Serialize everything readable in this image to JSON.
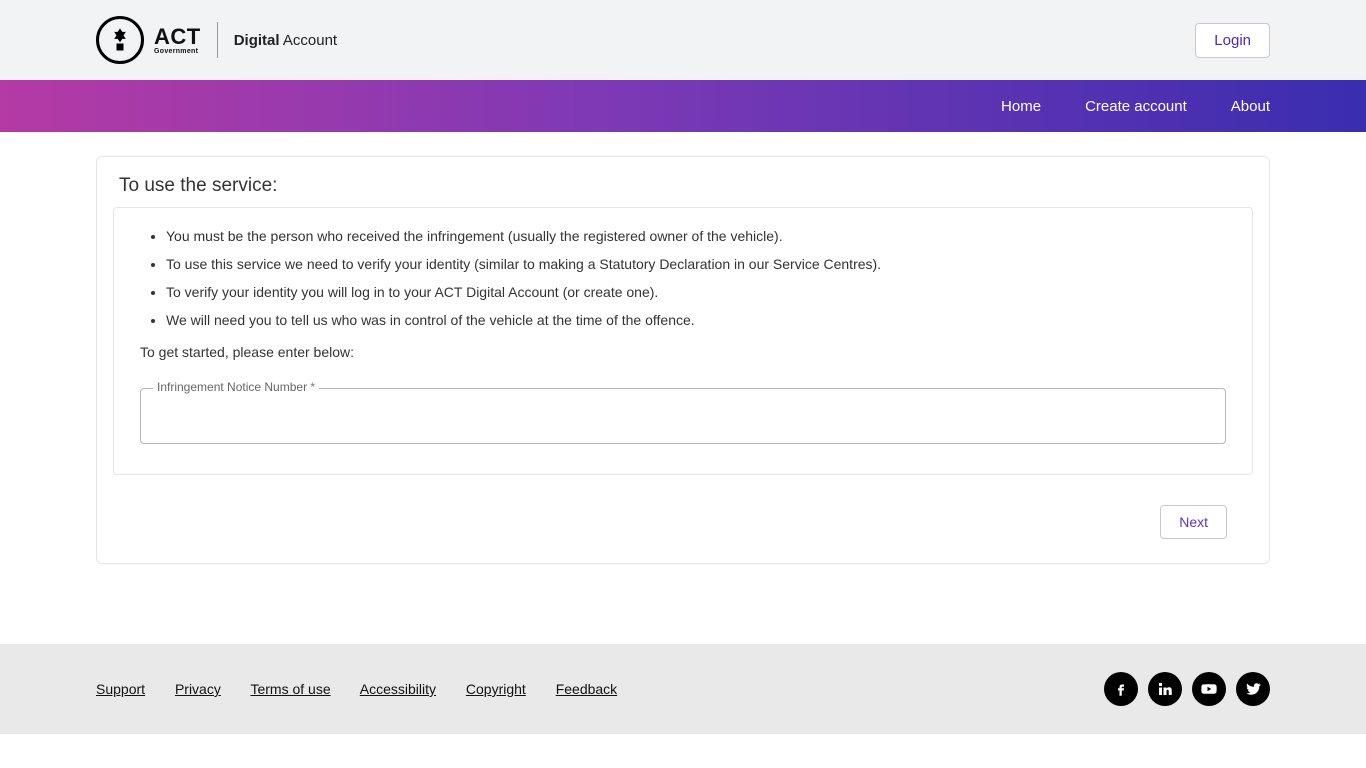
{
  "header": {
    "brand_main": "ACT",
    "brand_sub": "Government",
    "brand_right_bold": "Digital",
    "brand_right_light": " Account",
    "login_label": "Login"
  },
  "nav": {
    "home": "Home",
    "create": "Create account",
    "about": "About"
  },
  "card": {
    "title": "To use the service:",
    "bullets": [
      "You must be the person who received the infringement (usually the registered owner of the vehicle).",
      "To use this service we need to verify your identity (similar to making a Statutory Declaration in our Service Centres).",
      "To verify your identity you will log in to your ACT Digital Account (or create one).",
      "We will need you to tell us who was in control of the vehicle at the time of the offence."
    ],
    "lead": "To get started, please enter below:",
    "field_label": "Infringement Notice Number ",
    "field_required_mark": "*",
    "field_value": "",
    "next_label": "Next"
  },
  "footer": {
    "links": [
      "Support",
      "Privacy",
      "Terms of use",
      "Accessibility",
      "Copyright",
      "Feedback"
    ],
    "social": [
      "facebook",
      "linkedin",
      "youtube",
      "twitter"
    ]
  }
}
